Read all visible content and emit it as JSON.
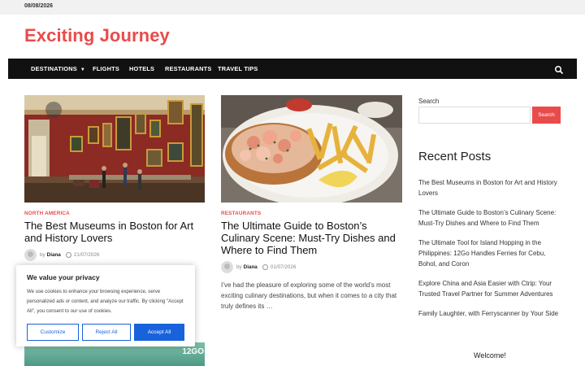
{
  "topbar": {
    "date": "08/08/2026"
  },
  "site": {
    "title": "Exciting Journey"
  },
  "nav": {
    "items": [
      "DESTINATIONS",
      "FLIGHTS",
      "HOTELS",
      "RESTAURANTS",
      "TRAVEL TIPS"
    ],
    "search_icon": "search-icon"
  },
  "posts": [
    {
      "category": "NORTH AMERICA",
      "title": "The Best Museums in Boston for Art and History Lovers",
      "by": "by",
      "author": "Diana",
      "date": "21/07/2026"
    },
    {
      "category": "RESTAURANTS",
      "title": "The Ultimate Guide to Boston’s Culinary Scene: Must-Try Dishes and Where to Find Them",
      "by": "by",
      "author": "Diana",
      "date": "01/07/2026",
      "excerpt": "I’ve had the pleasure of exploring some of the world’s most exciting culinary destinations, but when it comes to a city that truly defines its …"
    }
  ],
  "sidebar": {
    "search_label": "Search",
    "search_button": "Search",
    "search_placeholder": "",
    "recent_title": "Recent Posts",
    "recent_posts": [
      "The Best Museums in Boston for Art and History Lovers",
      "The Ultimate Guide to Boston’s Culinary Scene: Must-Try Dishes and Where to Find Them",
      "The Ultimate Tool for Island Hopping in the Philippines: 12Go Handles Ferries for Cebu, Bohol, and Coron",
      "Explore China and Asia Easier with Ctrip: Your Trusted Travel Partner for Summer Adventures",
      "Family Laughter, with Ferryscanner by Your Side"
    ],
    "welcome": "Welcome!"
  },
  "cookie": {
    "title": "We value your privacy",
    "text": "We use cookies to enhance your browsing experience, serve personalized ads or content, and analyze our traffic. By clicking \"Accept All\", you consent to our use of cookies.",
    "customize": "Customize",
    "reject": "Reject All",
    "accept": "Accept All"
  },
  "bottom_thumb": {
    "logo": "12GO"
  },
  "colors": {
    "accent": "#e94b4b",
    "nav_bg": "#111111",
    "cookie_blue": "#1863dc"
  }
}
